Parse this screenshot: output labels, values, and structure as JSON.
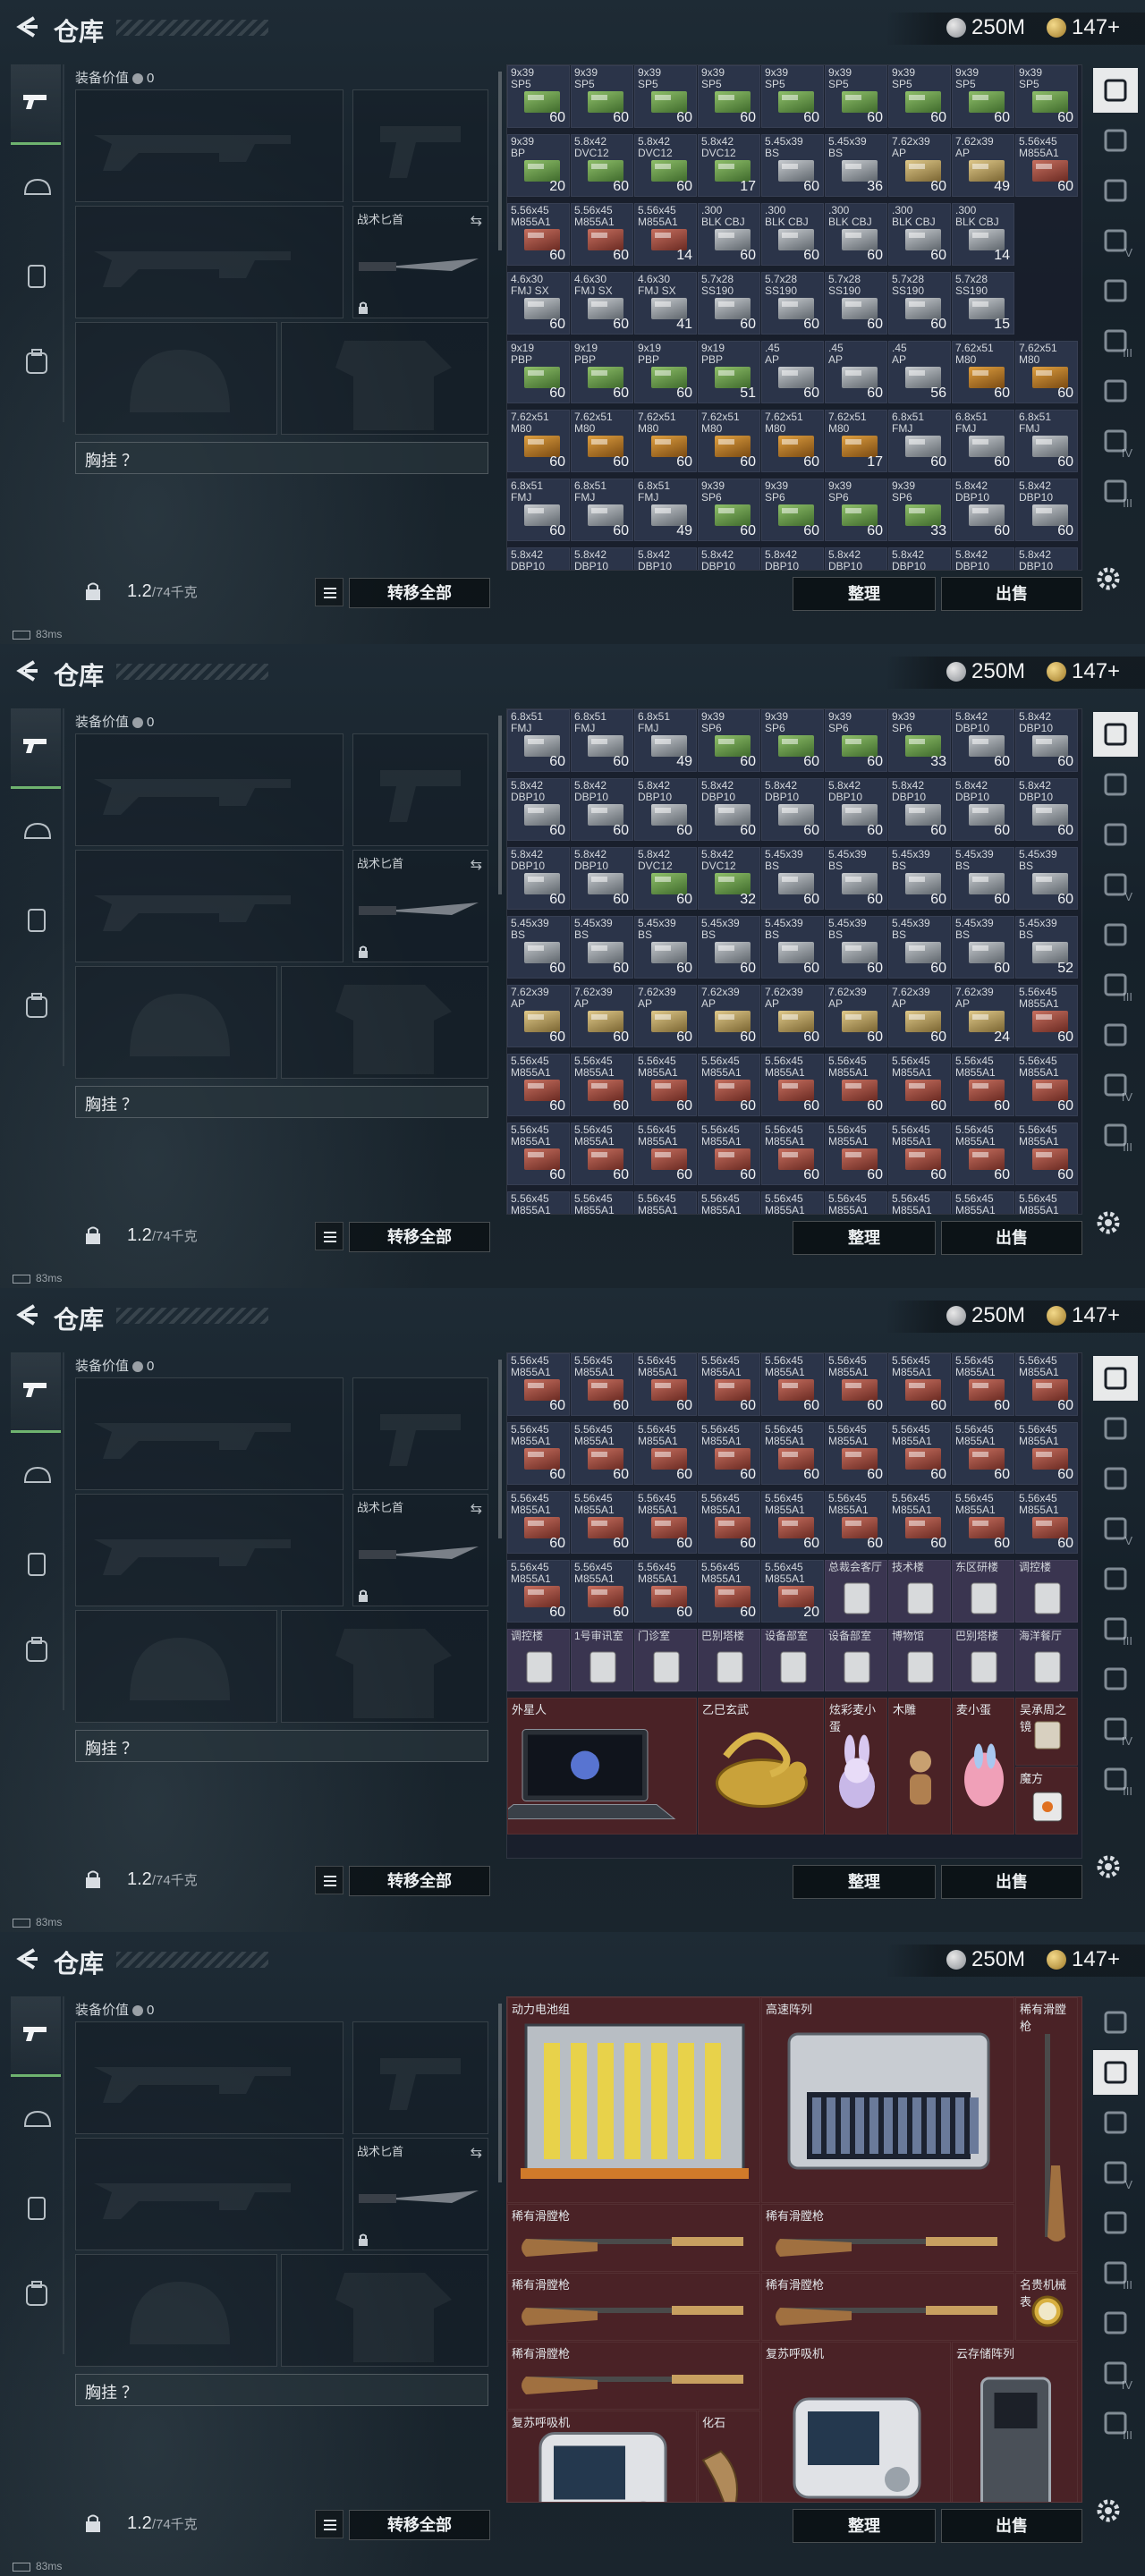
{
  "topbar": {
    "title": "仓库",
    "silver": "250M",
    "gold": "147+"
  },
  "equip": {
    "label": "装备价值",
    "value": "0",
    "knife": "战术匕首",
    "chest": "胸挂 ？",
    "weight": "1.2",
    "capacity": "/74千克",
    "transfer": "转移全部"
  },
  "actions": {
    "sort": "整理",
    "sell": "出售"
  },
  "status": "83ms",
  "side_labels": [
    "V",
    "III",
    "IV",
    "III"
  ],
  "icons": {
    "back": "back-arrow-icon",
    "silver": "silver-coin-icon",
    "gold": "gold-coin-icon",
    "settings": "gear-icon"
  },
  "screens": [
    {
      "cells": [
        [
          "9x39\nSP5",
          "60",
          "g"
        ],
        [
          "9x39\nSP5",
          "60",
          "g"
        ],
        [
          "9x39\nSP5",
          "60",
          "g"
        ],
        [
          "9x39\nSP5",
          "60",
          "g"
        ],
        [
          "9x39\nSP5",
          "60",
          "g"
        ],
        [
          "9x39\nSP5",
          "60",
          "g"
        ],
        [
          "9x39\nSP5",
          "60",
          "g"
        ],
        [
          "9x39\nSP5",
          "60",
          "g"
        ],
        [
          "9x39\nSP5",
          "60",
          "g"
        ],
        [
          "9x39\nBP",
          "20",
          "g"
        ],
        [
          "5.8x42\nDVC12",
          "60",
          "g"
        ],
        [
          "5.8x42\nDVC12",
          "60",
          "g"
        ],
        [
          "5.8x42\nDVC12",
          "17",
          "g"
        ],
        [
          "5.45x39\nBS",
          "60",
          "s"
        ],
        [
          "5.45x39\nBS",
          "36",
          "s"
        ],
        [
          "7.62x39\nAP",
          "60",
          "y"
        ],
        [
          "7.62x39\nAP",
          "49",
          "y"
        ],
        [
          "5.56x45\nM855A1",
          "60",
          "r"
        ],
        [
          "5.56x45\nM855A1",
          "60",
          "r"
        ],
        [
          "5.56x45\nM855A1",
          "60",
          "r"
        ],
        [
          "5.56x45\nM855A1",
          "14",
          "r"
        ],
        [
          ".300\nBLK CBJ",
          "60",
          "s"
        ],
        [
          ".300\nBLK CBJ",
          "60",
          "s"
        ],
        [
          ".300\nBLK CBJ",
          "60",
          "s"
        ],
        [
          ".300\nBLK CBJ",
          "60",
          "s"
        ],
        [
          ".300\nBLK CBJ",
          "14",
          "s"
        ],
        [
          "",
          "",
          ""
        ],
        [
          "4.6x30\nFMJ SX",
          "60",
          "s"
        ],
        [
          "4.6x30\nFMJ SX",
          "60",
          "s"
        ],
        [
          "4.6x30\nFMJ SX",
          "41",
          "s"
        ],
        [
          "5.7x28\nSS190",
          "60",
          "s"
        ],
        [
          "5.7x28\nSS190",
          "60",
          "s"
        ],
        [
          "5.7x28\nSS190",
          "60",
          "s"
        ],
        [
          "5.7x28\nSS190",
          "60",
          "s"
        ],
        [
          "5.7x28\nSS190",
          "15",
          "s"
        ],
        [
          "",
          "",
          ""
        ],
        [
          "9x19\nPBP",
          "60",
          "g"
        ],
        [
          "9x19\nPBP",
          "60",
          "g"
        ],
        [
          "9x19\nPBP",
          "60",
          "g"
        ],
        [
          "9x19\nPBP",
          "51",
          "g"
        ],
        [
          ".45\nAP",
          "60",
          "s"
        ],
        [
          ".45\nAP",
          "60",
          "s"
        ],
        [
          ".45\nAP",
          "56",
          "s"
        ],
        [
          "7.62x51\nM80",
          "60",
          "o"
        ],
        [
          "7.62x51\nM80",
          "60",
          "o"
        ],
        [
          "7.62x51\nM80",
          "60",
          "o"
        ],
        [
          "7.62x51\nM80",
          "60",
          "o"
        ],
        [
          "7.62x51\nM80",
          "60",
          "o"
        ],
        [
          "7.62x51\nM80",
          "60",
          "o"
        ],
        [
          "7.62x51\nM80",
          "60",
          "o"
        ],
        [
          "7.62x51\nM80",
          "17",
          "o"
        ],
        [
          "6.8x51\nFMJ",
          "60",
          "s"
        ],
        [
          "6.8x51\nFMJ",
          "60",
          "s"
        ],
        [
          "6.8x51\nFMJ",
          "60",
          "s"
        ],
        [
          "6.8x51\nFMJ",
          "60",
          "s"
        ],
        [
          "6.8x51\nFMJ",
          "60",
          "s"
        ],
        [
          "6.8x51\nFMJ",
          "49",
          "s"
        ],
        [
          "9x39\nSP6",
          "60",
          "g"
        ],
        [
          "9x39\nSP6",
          "60",
          "g"
        ],
        [
          "9x39\nSP6",
          "60",
          "g"
        ],
        [
          "9x39\nSP6",
          "33",
          "g"
        ],
        [
          "5.8x42\nDBP10",
          "60",
          "s"
        ],
        [
          "5.8x42\nDBP10",
          "60",
          "s"
        ],
        [
          "5.8x42\nDBP10",
          "60",
          "s"
        ],
        [
          "5.8x42\nDBP10",
          "60",
          "s"
        ],
        [
          "5.8x42\nDBP10",
          "60",
          "s"
        ],
        [
          "5.8x42\nDBP10",
          "60",
          "s"
        ],
        [
          "5.8x42\nDBP10",
          "60",
          "s"
        ],
        [
          "5.8x42\nDBP10",
          "60",
          "s"
        ],
        [
          "5.8x42\nDBP10",
          "60",
          "s"
        ],
        [
          "5.8x42\nDBP10",
          "60",
          "s"
        ],
        [
          "5.8x42\nDBP10",
          "60",
          "s"
        ]
      ]
    },
    {
      "cells": [
        [
          "6.8x51\nFMJ",
          "60",
          "s"
        ],
        [
          "6.8x51\nFMJ",
          "60",
          "s"
        ],
        [
          "6.8x51\nFMJ",
          "49",
          "s"
        ],
        [
          "9x39\nSP6",
          "60",
          "g"
        ],
        [
          "9x39\nSP6",
          "60",
          "g"
        ],
        [
          "9x39\nSP6",
          "60",
          "g"
        ],
        [
          "9x39\nSP6",
          "33",
          "g"
        ],
        [
          "5.8x42\nDBP10",
          "60",
          "s"
        ],
        [
          "5.8x42\nDBP10",
          "60",
          "s"
        ],
        [
          "5.8x42\nDBP10",
          "60",
          "s"
        ],
        [
          "5.8x42\nDBP10",
          "60",
          "s"
        ],
        [
          "5.8x42\nDBP10",
          "60",
          "s"
        ],
        [
          "5.8x42\nDBP10",
          "60",
          "s"
        ],
        [
          "5.8x42\nDBP10",
          "60",
          "s"
        ],
        [
          "5.8x42\nDBP10",
          "60",
          "s"
        ],
        [
          "5.8x42\nDBP10",
          "60",
          "s"
        ],
        [
          "5.8x42\nDBP10",
          "60",
          "s"
        ],
        [
          "5.8x42\nDBP10",
          "60",
          "s"
        ],
        [
          "5.8x42\nDBP10",
          "60",
          "s"
        ],
        [
          "5.8x42\nDBP10",
          "60",
          "s"
        ],
        [
          "5.8x42\nDVC12",
          "60",
          "g"
        ],
        [
          "5.8x42\nDVC12",
          "32",
          "g"
        ],
        [
          "5.45x39\nBS",
          "60",
          "s"
        ],
        [
          "5.45x39\nBS",
          "60",
          "s"
        ],
        [
          "5.45x39\nBS",
          "60",
          "s"
        ],
        [
          "5.45x39\nBS",
          "60",
          "s"
        ],
        [
          "5.45x39\nBS",
          "60",
          "s"
        ],
        [
          "5.45x39\nBS",
          "60",
          "s"
        ],
        [
          "5.45x39\nBS",
          "60",
          "s"
        ],
        [
          "5.45x39\nBS",
          "60",
          "s"
        ],
        [
          "5.45x39\nBS",
          "60",
          "s"
        ],
        [
          "5.45x39\nBS",
          "60",
          "s"
        ],
        [
          "5.45x39\nBS",
          "60",
          "s"
        ],
        [
          "5.45x39\nBS",
          "60",
          "s"
        ],
        [
          "5.45x39\nBS",
          "60",
          "s"
        ],
        [
          "5.45x39\nBS",
          "52",
          "s"
        ],
        [
          "7.62x39\nAP",
          "60",
          "y"
        ],
        [
          "7.62x39\nAP",
          "60",
          "y"
        ],
        [
          "7.62x39\nAP",
          "60",
          "y"
        ],
        [
          "7.62x39\nAP",
          "60",
          "y"
        ],
        [
          "7.62x39\nAP",
          "60",
          "y"
        ],
        [
          "7.62x39\nAP",
          "60",
          "y"
        ],
        [
          "7.62x39\nAP",
          "60",
          "y"
        ],
        [
          "7.62x39\nAP",
          "24",
          "y"
        ],
        [
          "5.56x45\nM855A1",
          "60",
          "r"
        ],
        [
          "5.56x45\nM855A1",
          "60",
          "r"
        ],
        [
          "5.56x45\nM855A1",
          "60",
          "r"
        ],
        [
          "5.56x45\nM855A1",
          "60",
          "r"
        ],
        [
          "5.56x45\nM855A1",
          "60",
          "r"
        ],
        [
          "5.56x45\nM855A1",
          "60",
          "r"
        ],
        [
          "5.56x45\nM855A1",
          "60",
          "r"
        ],
        [
          "5.56x45\nM855A1",
          "60",
          "r"
        ],
        [
          "5.56x45\nM855A1",
          "60",
          "r"
        ],
        [
          "5.56x45\nM855A1",
          "60",
          "r"
        ],
        [
          "5.56x45\nM855A1",
          "60",
          "r"
        ],
        [
          "5.56x45\nM855A1",
          "60",
          "r"
        ],
        [
          "5.56x45\nM855A1",
          "60",
          "r"
        ],
        [
          "5.56x45\nM855A1",
          "60",
          "r"
        ],
        [
          "5.56x45\nM855A1",
          "60",
          "r"
        ],
        [
          "5.56x45\nM855A1",
          "60",
          "r"
        ],
        [
          "5.56x45\nM855A1",
          "60",
          "r"
        ],
        [
          "5.56x45\nM855A1",
          "60",
          "r"
        ],
        [
          "5.56x45\nM855A1",
          "60",
          "r"
        ],
        [
          "5.56x45\nM855A1",
          "60",
          "r"
        ],
        [
          "5.56x45\nM855A1",
          "60",
          "r"
        ],
        [
          "5.56x45\nM855A1",
          "60",
          "r"
        ],
        [
          "5.56x45\nM855A1",
          "60",
          "r"
        ],
        [
          "5.56x45\nM855A1",
          "60",
          "r"
        ],
        [
          "5.56x45\nM855A1",
          "60",
          "r"
        ],
        [
          "5.56x45\nM855A1",
          "60",
          "r"
        ],
        [
          "5.56x45\nM855A1",
          "60",
          "r"
        ],
        [
          "5.56x45\nM855A1",
          "60",
          "r"
        ]
      ]
    },
    {
      "cells": [
        [
          "5.56x45\nM855A1",
          "60",
          "r"
        ],
        [
          "5.56x45\nM855A1",
          "60",
          "r"
        ],
        [
          "5.56x45\nM855A1",
          "60",
          "r"
        ],
        [
          "5.56x45\nM855A1",
          "60",
          "r"
        ],
        [
          "5.56x45\nM855A1",
          "60",
          "r"
        ],
        [
          "5.56x45\nM855A1",
          "60",
          "r"
        ],
        [
          "5.56x45\nM855A1",
          "60",
          "r"
        ],
        [
          "5.56x45\nM855A1",
          "60",
          "r"
        ],
        [
          "5.56x45\nM855A1",
          "60",
          "r"
        ],
        [
          "5.56x45\nM855A1",
          "60",
          "r"
        ],
        [
          "5.56x45\nM855A1",
          "60",
          "r"
        ],
        [
          "5.56x45\nM855A1",
          "60",
          "r"
        ],
        [
          "5.56x45\nM855A1",
          "60",
          "r"
        ],
        [
          "5.56x45\nM855A1",
          "60",
          "r"
        ],
        [
          "5.56x45\nM855A1",
          "60",
          "r"
        ],
        [
          "5.56x45\nM855A1",
          "60",
          "r"
        ],
        [
          "5.56x45\nM855A1",
          "60",
          "r"
        ],
        [
          "5.56x45\nM855A1",
          "60",
          "r"
        ],
        [
          "5.56x45\nM855A1",
          "60",
          "r"
        ],
        [
          "5.56x45\nM855A1",
          "60",
          "r"
        ],
        [
          "5.56x45\nM855A1",
          "60",
          "r"
        ],
        [
          "5.56x45\nM855A1",
          "60",
          "r"
        ],
        [
          "5.56x45\nM855A1",
          "60",
          "r"
        ],
        [
          "5.56x45\nM855A1",
          "60",
          "r"
        ],
        [
          "5.56x45\nM855A1",
          "60",
          "r"
        ],
        [
          "5.56x45\nM855A1",
          "60",
          "r"
        ],
        [
          "5.56x45\nM855A1",
          "60",
          "r"
        ],
        [
          "5.56x45\nM855A1",
          "60",
          "r"
        ],
        [
          "5.56x45\nM855A1",
          "60",
          "r"
        ],
        [
          "5.56x45\nM855A1",
          "60",
          "r"
        ],
        [
          "5.56x45\nM855A1",
          "60",
          "r"
        ],
        [
          "5.56x45\nM855A1",
          "20",
          "r"
        ],
        [
          "总裁会客厅",
          "",
          "key"
        ],
        [
          "技术楼",
          "",
          "key"
        ],
        [
          "东区研楼",
          "",
          "key"
        ],
        [
          "调控楼",
          "",
          "key"
        ],
        [
          "调控楼",
          "",
          "key"
        ],
        [
          "1号审讯室",
          "",
          "key"
        ],
        [
          "门诊室",
          "",
          "key"
        ],
        [
          "巴别塔楼",
          "",
          "key"
        ],
        [
          "设备部室",
          "",
          "key"
        ],
        [
          "设备部室",
          "",
          "key"
        ],
        [
          "博物馆",
          "",
          "key"
        ],
        [
          "巴别塔楼",
          "",
          "key"
        ],
        [
          "海洋餐厅",
          "",
          "key"
        ]
      ],
      "items": [
        {
          "name": "外星人",
          "kind": "laptop",
          "col": 0,
          "row": 5,
          "w": 3,
          "h": 2
        },
        {
          "name": "乙巳玄武",
          "kind": "tortoise",
          "col": 3,
          "row": 5,
          "w": 2,
          "h": 2
        },
        {
          "name": "炫彩麦小蛋",
          "kind": "bunny",
          "col": 5,
          "row": 5,
          "w": 1,
          "h": 2
        },
        {
          "name": "木雕",
          "kind": "carving",
          "col": 6,
          "row": 5,
          "w": 1,
          "h": 2
        },
        {
          "name": "麦小蛋",
          "kind": "egg",
          "col": 7,
          "row": 5,
          "w": 1,
          "h": 2
        },
        {
          "name": "吴承周之镜",
          "kind": "mirror",
          "col": 8,
          "row": 5,
          "w": 1,
          "h": 1
        },
        {
          "name": "魔方",
          "kind": "cube",
          "col": 8,
          "row": 6,
          "w": 1,
          "h": 1
        }
      ]
    },
    {
      "cells": [],
      "items": [
        {
          "name": "动力电池组",
          "kind": "battery",
          "col": 0,
          "row": 0,
          "w": 4,
          "h": 3
        },
        {
          "name": "高速阵列",
          "kind": "server",
          "col": 4,
          "row": 0,
          "w": 4,
          "h": 3
        },
        {
          "name": "稀有滑膛枪",
          "kind": "musket-v",
          "col": 8,
          "row": 0,
          "w": 1,
          "h": 4
        },
        {
          "name": "稀有滑膛枪",
          "kind": "musket",
          "col": 0,
          "row": 3,
          "w": 4,
          "h": 1
        },
        {
          "name": "稀有滑膛枪",
          "kind": "musket",
          "col": 4,
          "row": 3,
          "w": 4,
          "h": 1
        },
        {
          "name": "稀有滑膛枪",
          "kind": "musket",
          "col": 0,
          "row": 4,
          "w": 4,
          "h": 1
        },
        {
          "name": "稀有滑膛枪",
          "kind": "musket",
          "col": 4,
          "row": 4,
          "w": 4,
          "h": 1
        },
        {
          "name": "名贵机械表",
          "kind": "watch",
          "col": 8,
          "row": 4,
          "w": 1,
          "h": 1
        },
        {
          "name": "稀有滑膛枪",
          "kind": "musket",
          "col": 0,
          "row": 5,
          "w": 4,
          "h": 1
        },
        {
          "name": "复苏呼吸机",
          "kind": "ventilator",
          "col": 4,
          "row": 5,
          "w": 3,
          "h": 3
        },
        {
          "name": "云存储阵列",
          "kind": "storage",
          "col": 7,
          "row": 5,
          "w": 2,
          "h": 3
        },
        {
          "name": "复苏呼吸机",
          "kind": "ventilator",
          "col": 0,
          "row": 6,
          "w": 3,
          "h": 2
        },
        {
          "name": "化石",
          "kind": "fossil",
          "col": 3,
          "row": 6,
          "w": 1,
          "h": 2
        }
      ]
    }
  ]
}
